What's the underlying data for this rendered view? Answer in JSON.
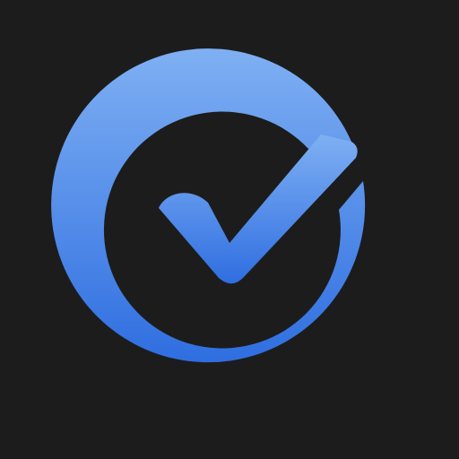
{
  "icon": {
    "name": "checkmark-circle-icon",
    "colors": {
      "background": "#1c1c1c",
      "gradient_top": "#7fb0f3",
      "gradient_bottom": "#2f6ee0"
    }
  }
}
